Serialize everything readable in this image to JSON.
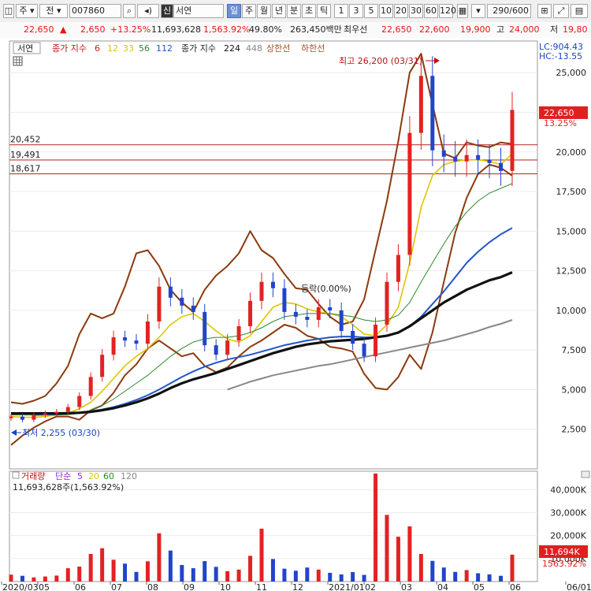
{
  "toolbar": {
    "market": "주",
    "prefix": "전",
    "code": "007860",
    "shin": "신",
    "name": "서연",
    "periods": [
      "일",
      "주",
      "월",
      "년",
      "분",
      "초",
      "틱"
    ],
    "active_period": "일",
    "intervals": [
      "1",
      "3",
      "5",
      "10",
      "20",
      "30",
      "60",
      "120"
    ],
    "count": "290",
    "total": "/600"
  },
  "quote": {
    "price": "22,650",
    "arrow": "▲",
    "change": "2,650",
    "change_pct": "+13.25%",
    "volume": "11,693,628",
    "volume_pct": "1,563.92%",
    "turnover": "49.80%",
    "amount": "263,450백만",
    "best_ask_label": "최우선",
    "best_ask": "22,650",
    "best_bid": "22,600",
    "low": "19,900",
    "high_label": "고",
    "high": "24,000",
    "low_label": "저",
    "low2": "19,80"
  },
  "legend": {
    "name": "서연",
    "ma_label": "종가 지수",
    "ma": [
      "6",
      "12",
      "33",
      "56",
      "112"
    ],
    "ma_colors": [
      "#d01818",
      "#e0c400",
      "#d8c800",
      "#2a8a2a",
      "#2255cc"
    ],
    "ma2_label": "종가 지수",
    "ma2": [
      "224",
      "448"
    ],
    "upper": "상한선",
    "lower": "하한선"
  },
  "corner": {
    "lc": "LC:904.43",
    "hc": "HC:-13.55"
  },
  "price_tag": {
    "value": "22,650",
    "pct": "13.25%"
  },
  "hlines": [
    "20,452",
    "19,491",
    "18,617"
  ],
  "annotations": {
    "high": "최고 26,200 (03/31)",
    "low": "최저 2,255 (03/30)",
    "mid": "등락(0.00%)"
  },
  "volume_legend": {
    "label": "거래량",
    "ma_label": "단순",
    "ma": [
      "5",
      "20",
      "60",
      "120"
    ],
    "value": "11,693,628주(1,563.92%)"
  },
  "volume_tag": {
    "value": "11,694K",
    "pct": "1563.92%"
  },
  "chart_data": [
    {
      "type": "candlestick",
      "title": "서연 007860",
      "xlabel": "",
      "ylabel": "",
      "ylim": [
        0,
        27000
      ],
      "yticks": [
        2500,
        5000,
        7500,
        10000,
        12500,
        15000,
        17500,
        20000,
        22500,
        25000
      ],
      "ytick_labels": [
        "2,500",
        "5,000",
        "7,500",
        "10,000",
        "12,500",
        "15,000",
        "17,500",
        "20,000",
        "22,500",
        "25,000"
      ],
      "x_labels": [
        "2020/03",
        "05",
        "06",
        "07",
        "08",
        "09",
        "10",
        "11",
        "12",
        "2021/01",
        "02",
        "03",
        "04",
        "05",
        "06",
        "06/01"
      ],
      "close": [
        3300,
        3100,
        3400,
        3500,
        3600,
        3900,
        4600,
        5800,
        7200,
        8300,
        8100,
        7900,
        9300,
        11500,
        10800,
        10300,
        9900,
        7800,
        7200,
        8100,
        9000,
        10600,
        11800,
        11400,
        9900,
        9600,
        9400,
        10200,
        10000,
        8700,
        7900,
        7100,
        9100,
        11800,
        13500,
        21200,
        24800,
        20100,
        19700,
        19400,
        19800,
        19500,
        19300,
        18800,
        22650
      ],
      "ma": [
        {
          "name": "6",
          "color": "#d01818",
          "values": [
            3300,
            3200,
            3250,
            3400,
            3550,
            3700,
            4200,
            5000,
            6000,
            7100,
            7700,
            7900,
            8600,
            10000,
            10600,
            10700,
            10200,
            8800,
            7800,
            7700,
            8300,
            9600,
            11000,
            11300,
            10500,
            9900,
            9500,
            9800,
            9900,
            9200,
            8300,
            7500,
            8500,
            10600,
            12700,
            18000,
            22500,
            21500,
            20300,
            19700,
            19600,
            19500,
            19400,
            19000,
            20600
          ]
        },
        {
          "name": "12",
          "color": "#e0c400",
          "values": [
            3300,
            3250,
            3250,
            3300,
            3400,
            3500,
            3800,
            4200,
            4900,
            5700,
            6500,
            7100,
            7600,
            8300,
            9100,
            9600,
            9800,
            9300,
            8700,
            8200,
            8000,
            8400,
            9300,
            10200,
            10500,
            10400,
            10100,
            9900,
            9800,
            9600,
            9100,
            8500,
            8400,
            9100,
            10200,
            13000,
            16500,
            18500,
            19200,
            19400,
            19500,
            19500,
            19400,
            19200,
            19900
          ]
        },
        {
          "name": "33",
          "color": "#2a8a2a",
          "values": [
            3400,
            3400,
            3400,
            3400,
            3400,
            3420,
            3500,
            3700,
            4000,
            4400,
            4900,
            5400,
            5900,
            6500,
            7100,
            7600,
            8000,
            8200,
            8300,
            8300,
            8400,
            8600,
            8900,
            9300,
            9600,
            9700,
            9800,
            9800,
            9800,
            9700,
            9600,
            9400,
            9300,
            9400,
            9700,
            10500,
            11800,
            13000,
            14200,
            15300,
            16200,
            16900,
            17400,
            17700,
            18000
          ]
        },
        {
          "name": "112",
          "color": "#2255cc",
          "values": [
            null,
            null,
            3400,
            3420,
            3450,
            3500,
            3560,
            3640,
            3750,
            3900,
            4100,
            4350,
            4650,
            5000,
            5400,
            5800,
            6150,
            6450,
            6700,
            6900,
            7050,
            7200,
            7400,
            7600,
            7800,
            7950,
            8100,
            8200,
            8300,
            8350,
            8350,
            8300,
            8300,
            8400,
            8600,
            9000,
            9600,
            10400,
            11200,
            12100,
            13000,
            13700,
            14300,
            14800,
            15200
          ]
        },
        {
          "name": "224",
          "color": "#111111",
          "values": [
            3500,
            3500,
            3500,
            3500,
            3500,
            3510,
            3540,
            3600,
            3700,
            3830,
            4000,
            4200,
            4450,
            4750,
            5100,
            5400,
            5650,
            5850,
            6050,
            6300,
            6550,
            6800,
            7050,
            7300,
            7500,
            7700,
            7850,
            7950,
            8050,
            8100,
            8150,
            8200,
            8300,
            8400,
            8600,
            9000,
            9500,
            10000,
            10500,
            10900,
            11300,
            11600,
            11900,
            12100,
            12400
          ]
        },
        {
          "name": "448",
          "color": "#888888",
          "values": [
            null,
            null,
            null,
            null,
            null,
            null,
            null,
            null,
            null,
            null,
            null,
            null,
            null,
            null,
            null,
            null,
            null,
            null,
            null,
            5000,
            5250,
            5500,
            5700,
            5900,
            6050,
            6200,
            6350,
            6500,
            6600,
            6750,
            6900,
            7050,
            7200,
            7350,
            7500,
            7650,
            7800,
            7950,
            8100,
            8300,
            8500,
            8700,
            8950,
            9150,
            9400
          ]
        }
      ],
      "envelope_upper": [
        4200,
        4100,
        4300,
        4600,
        5400,
        6500,
        8500,
        9800,
        9500,
        9800,
        11500,
        13600,
        13800,
        12800,
        11300,
        10500,
        9900,
        11300,
        12200,
        12800,
        13600,
        15000,
        13800,
        13300,
        12300,
        11400,
        11300,
        10400,
        9600,
        9100,
        9300,
        10700,
        13800,
        16900,
        20700,
        25000,
        26200,
        23000,
        19900,
        19600,
        20600,
        20400,
        20300,
        20600,
        20500
      ],
      "envelope_lower": [
        1500,
        2100,
        2600,
        3000,
        3300,
        3300,
        3100,
        3700,
        4000,
        4800,
        5900,
        6600,
        7600,
        8100,
        7600,
        7100,
        7300,
        6500,
        6100,
        6400,
        7100,
        7700,
        8100,
        8600,
        9100,
        8900,
        8400,
        8200,
        7700,
        7600,
        7400,
        6000,
        5100,
        5000,
        5800,
        7200,
        6300,
        8600,
        11800,
        14900,
        17100,
        18600,
        19200,
        19000,
        18500
      ]
    },
    {
      "type": "bar",
      "title": "거래량",
      "ylabel": "",
      "ylim": [
        0,
        48000
      ],
      "yticks": [
        10000,
        20000,
        30000,
        40000
      ],
      "ytick_labels": [
        "10,000K",
        "20,000K",
        "30,000K",
        "40,000K"
      ],
      "values": [
        3000,
        2500,
        1800,
        2200,
        2600,
        5800,
        6500,
        12000,
        14500,
        9500,
        7800,
        4200,
        8800,
        21000,
        13500,
        7200,
        5800,
        8900,
        6400,
        4500,
        5200,
        11200,
        23000,
        9800,
        5600,
        4700,
        6100,
        5200,
        3800,
        3100,
        4100,
        2900,
        47000,
        29000,
        19500,
        24000,
        12000,
        9000,
        6100,
        4200,
        5000,
        3600,
        3100,
        2500,
        11694
      ]
    }
  ]
}
